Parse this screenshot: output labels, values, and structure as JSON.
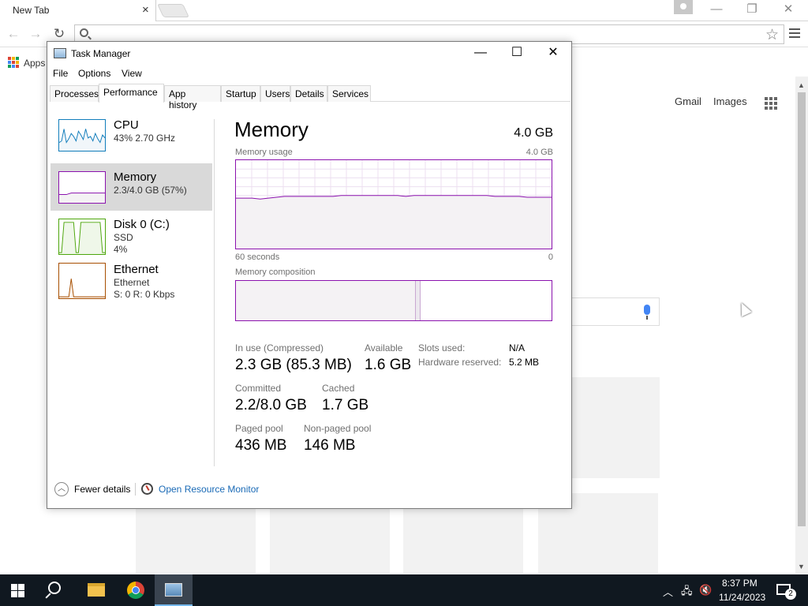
{
  "browser": {
    "tab_title": "New Tab",
    "tab_close": "×",
    "apps_label": "Apps",
    "header_links": [
      "Gmail",
      "Images"
    ],
    "window_controls": {
      "minimize": "—",
      "maximize": "❐",
      "close": "✕"
    },
    "nav": {
      "back": "←",
      "forward": "→",
      "reload": "↻"
    },
    "star": "☆"
  },
  "task_manager": {
    "title": "Task Manager",
    "controls": {
      "minimize": "—",
      "maximize": "☐",
      "close": "✕"
    },
    "menu": [
      "File",
      "Options",
      "View"
    ],
    "tabs": [
      "Processes",
      "Performance",
      "App history",
      "Startup",
      "Users",
      "Details",
      "Services"
    ],
    "active_tab": "Performance",
    "side_items": [
      {
        "name": "CPU",
        "line1": "43%  2.70 GHz",
        "line2": "",
        "color": "#117dbb",
        "fill": "#f1f6fa"
      },
      {
        "name": "Memory",
        "line1": "2.3/4.0 GB (57%)",
        "line2": "",
        "color": "#8b12ae",
        "fill": "#f4f2f4"
      },
      {
        "name": "Disk 0 (C:)",
        "line1": "SSD",
        "line2": "4%",
        "color": "#4da60c",
        "fill": "#eff7e9"
      },
      {
        "name": "Ethernet",
        "line1": "Ethernet",
        "line2": "S: 0  R: 0 Kbps",
        "color": "#a74f01",
        "fill": "#fcf3eb"
      }
    ],
    "main": {
      "title": "Memory",
      "total": "4.0 GB",
      "usage_label": "Memory usage",
      "usage_max": "4.0 GB",
      "time_left": "60 seconds",
      "time_right": "0",
      "composition_label": "Memory composition",
      "composition": {
        "in_use_fraction": 0.57,
        "modified_fraction": 0.015
      },
      "usage_series_percent": [
        57,
        57,
        57,
        56,
        57,
        58,
        59,
        59,
        59,
        59,
        59,
        59,
        59,
        60,
        60,
        60,
        60,
        60,
        60,
        60,
        60,
        59,
        60,
        60,
        60,
        60,
        60,
        60,
        60,
        60,
        60,
        60,
        59,
        59,
        59,
        59,
        58,
        58,
        58,
        58
      ],
      "stats": {
        "in_use_label": "In use (Compressed)",
        "in_use_value": "2.3 GB (85.3 MB)",
        "available_label": "Available",
        "available_value": "1.6 GB",
        "committed_label": "Committed",
        "committed_value": "2.2/8.0 GB",
        "cached_label": "Cached",
        "cached_value": "1.7 GB",
        "paged_label": "Paged pool",
        "paged_value": "436 MB",
        "nonpaged_label": "Non-paged pool",
        "nonpaged_value": "146 MB",
        "slots_label": "Slots used:",
        "slots_value": "N/A",
        "hw_label": "Hardware reserved:",
        "hw_value": "5.2 MB"
      }
    },
    "footer": {
      "fewer_details": "Fewer details",
      "open_resource_monitor": "Open Resource Monitor"
    }
  },
  "taskbar": {
    "time": "8:37 PM",
    "date": "11/24/2023",
    "notification_count": "2",
    "tray_icons": [
      "chevron-up-icon",
      "network-icon",
      "volume-muted-icon"
    ]
  }
}
